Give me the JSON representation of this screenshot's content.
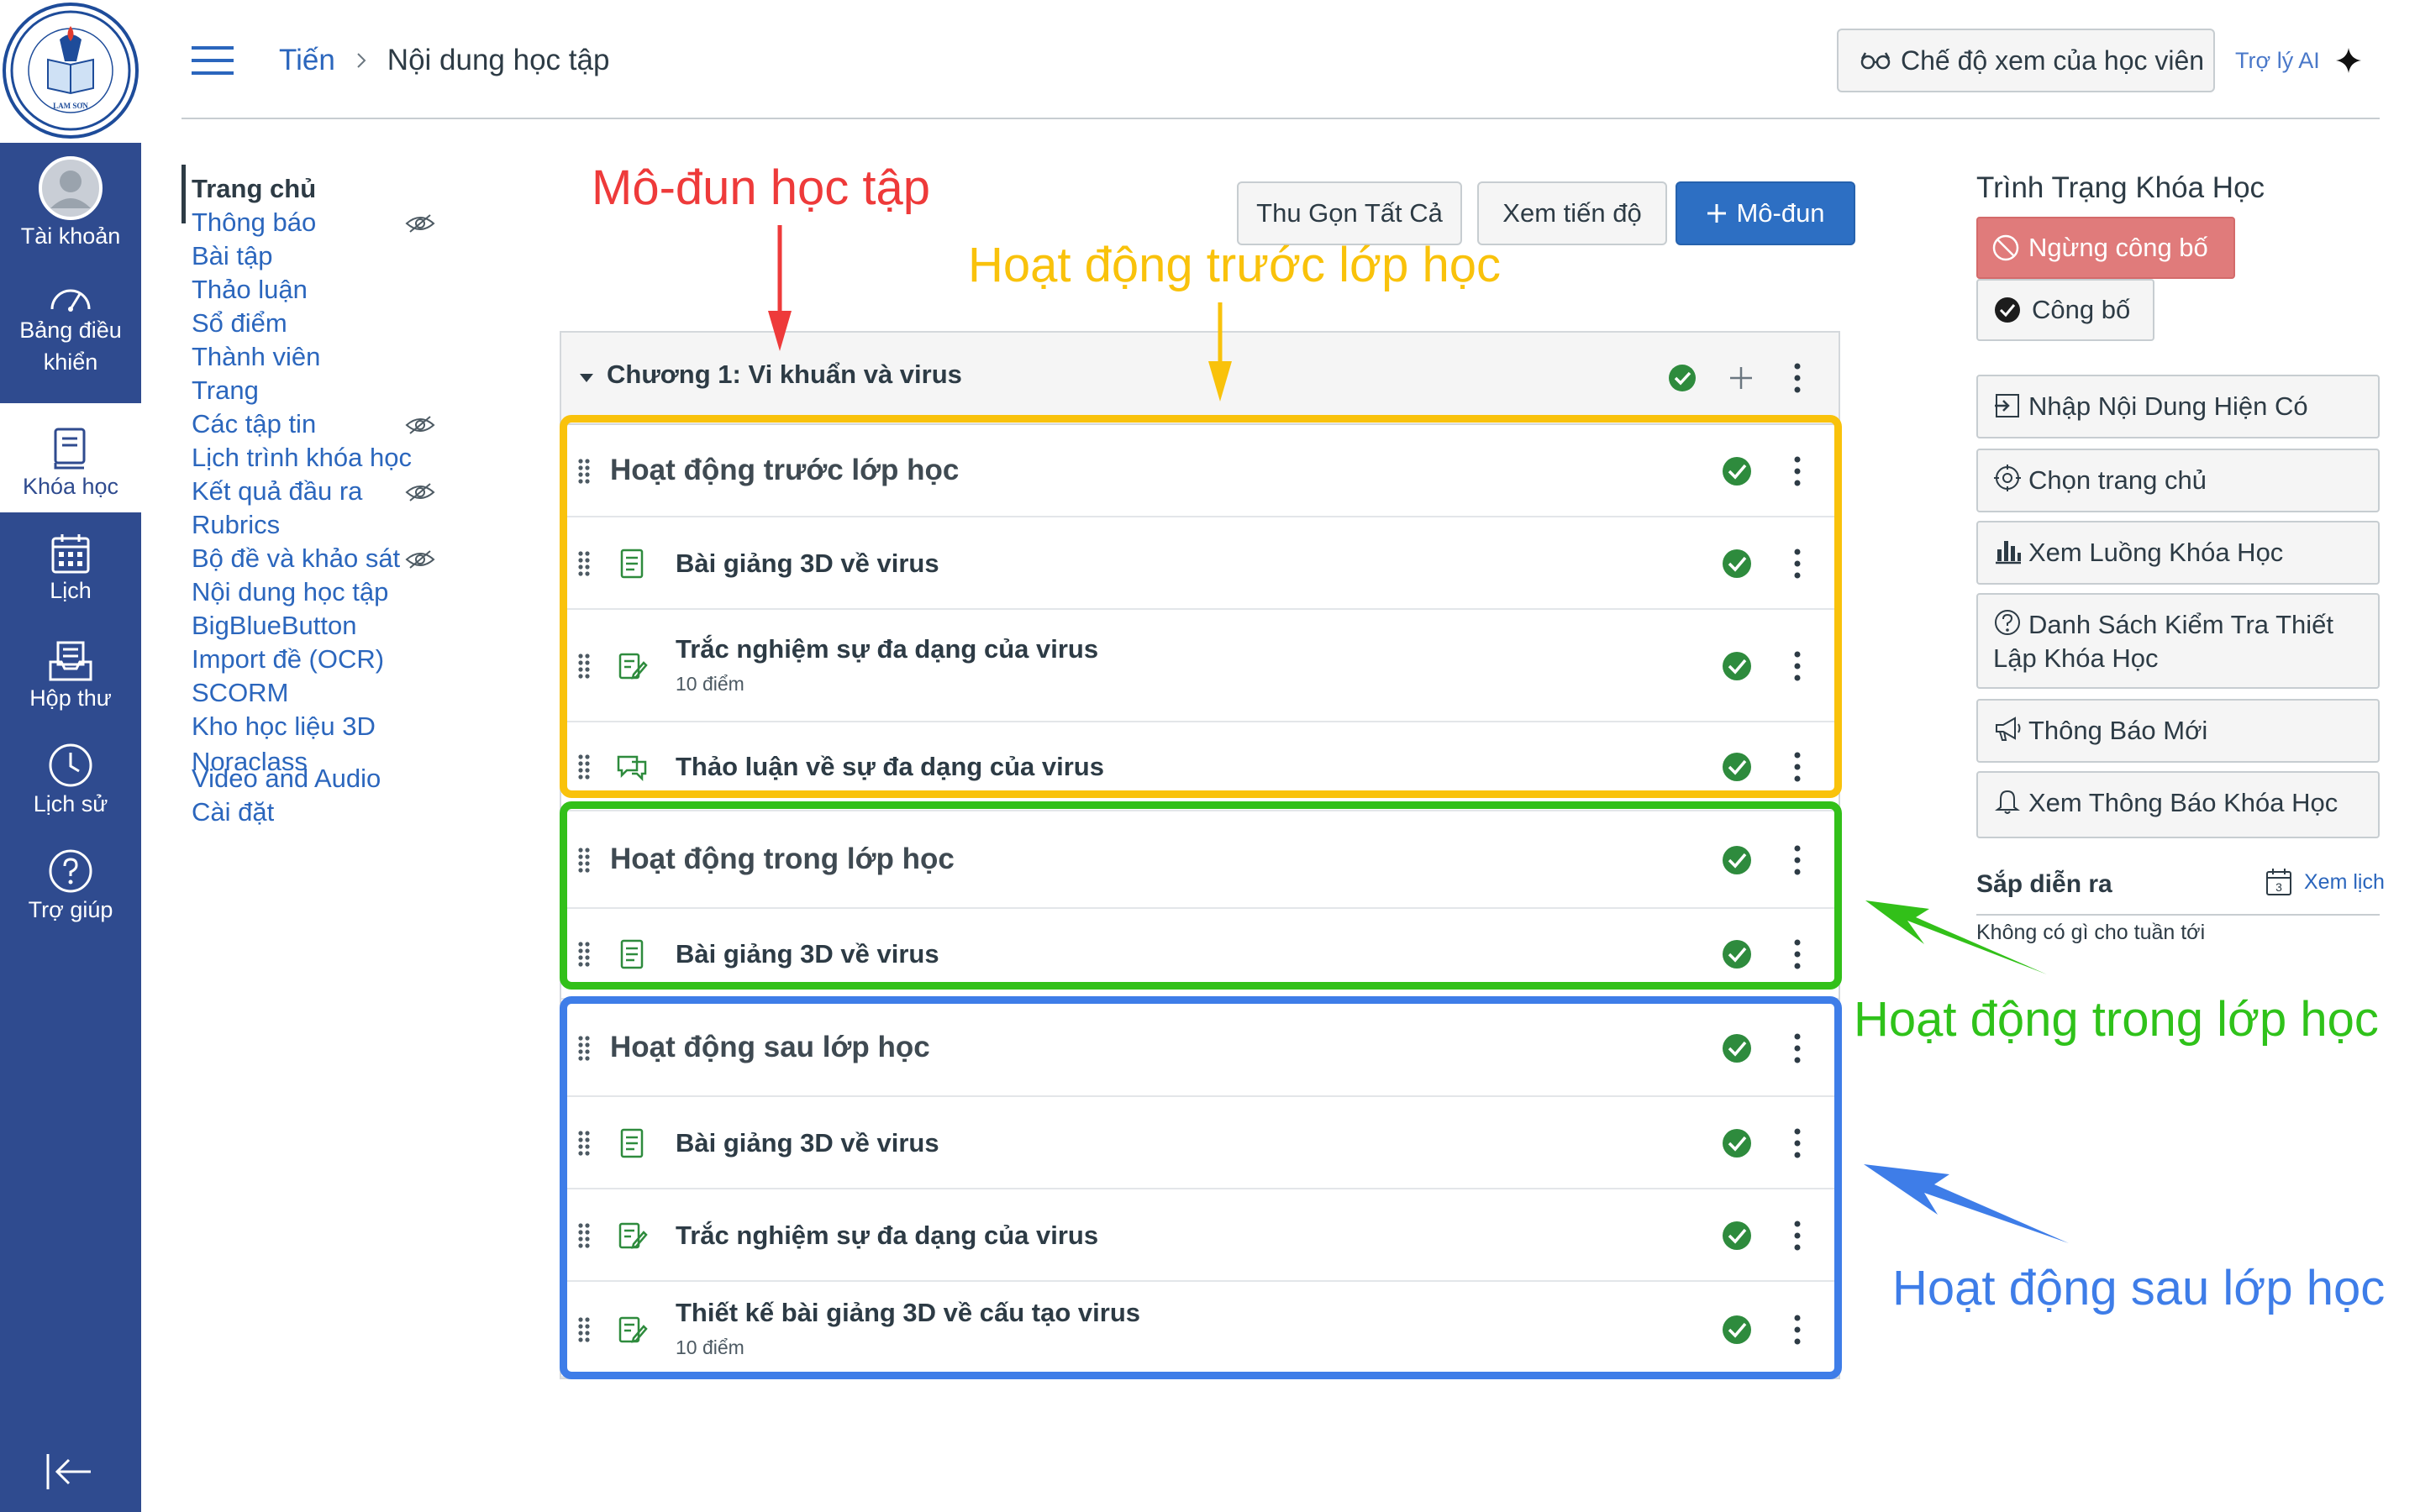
{
  "global_nav": {
    "items": [
      {
        "label": "Tài khoản",
        "icon": "account-avatar-icon"
      },
      {
        "label": "Bảng điều khiển",
        "icon": "dashboard-icon"
      },
      {
        "label": "Khóa học",
        "icon": "courses-icon",
        "active": true
      },
      {
        "label": "Lịch",
        "icon": "calendar-icon"
      },
      {
        "label": "Hộp thư",
        "icon": "inbox-icon"
      },
      {
        "label": "Lịch sử",
        "icon": "history-icon"
      },
      {
        "label": "Trợ giúp",
        "icon": "help-icon"
      }
    ]
  },
  "header": {
    "breadcrumb": {
      "course": "Tiến",
      "current": "Nội dung học tập"
    },
    "student_view_label": "Chế độ xem của học viên",
    "ai_assistant_label": "Trợ lý AI"
  },
  "course_nav": {
    "items": [
      {
        "label": "Trang chủ",
        "active": true
      },
      {
        "label": "Thông báo",
        "hidden": true
      },
      {
        "label": "Bài tập"
      },
      {
        "label": "Thảo luận"
      },
      {
        "label": "Sổ điểm"
      },
      {
        "label": "Thành viên"
      },
      {
        "label": "Trang"
      },
      {
        "label": "Các tập tin",
        "hidden": true
      },
      {
        "label": "Lịch trình khóa học"
      },
      {
        "label": "Kết quả đầu ra",
        "hidden": true
      },
      {
        "label": "Rubrics"
      },
      {
        "label": "Bộ đề và khảo sát",
        "hidden": true
      },
      {
        "label": "Nội dung học tập"
      },
      {
        "label": "BigBlueButton"
      },
      {
        "label": "Import đề (OCR)"
      },
      {
        "label": "SCORM"
      },
      {
        "label": "Kho học liệu 3D Noraclass"
      },
      {
        "label": "Video and Audio"
      },
      {
        "label": "Cài đặt"
      }
    ]
  },
  "toolbar": {
    "collapse_all": "Thu Gọn Tất Cả",
    "view_progress": "Xem tiến độ",
    "add_module": "Mô-đun"
  },
  "module": {
    "title": "Chương 1: Vi khuẩn và virus",
    "published": true,
    "rows": [
      {
        "kind": "header",
        "title": "Hoạt động trước lớp học"
      },
      {
        "kind": "item",
        "type": "page",
        "title": "Bài giảng 3D về virus"
      },
      {
        "kind": "item",
        "type": "quiz",
        "title": "Trắc nghiệm sự đa dạng của virus",
        "subtitle": "10 điểm"
      },
      {
        "kind": "item",
        "type": "discussion",
        "title": "Thảo luận về sự đa dạng của virus"
      },
      {
        "kind": "header",
        "title": "Hoạt động trong lớp học"
      },
      {
        "kind": "item",
        "type": "page",
        "title": "Bài giảng 3D về virus"
      },
      {
        "kind": "header",
        "title": "Hoạt động sau lớp học"
      },
      {
        "kind": "item",
        "type": "page",
        "title": "Bài giảng 3D về virus"
      },
      {
        "kind": "item",
        "type": "quiz",
        "title": "Trắc nghiệm sự đa dạng của virus"
      },
      {
        "kind": "item",
        "type": "quiz",
        "title": "Thiết kế bài giảng 3D về cấu tạo virus",
        "subtitle": "10 điểm"
      }
    ]
  },
  "annotations": {
    "module": "Mô-đun học tập",
    "pre_class": "Hoạt động trước lớp học",
    "in_class": "Hoạt động trong lớp học",
    "post_class": "Hoạt động sau lớp học"
  },
  "sidebar": {
    "course_status_heading": "Trình Trạng Khóa Học",
    "unpublish_label": "Ngừng công bố",
    "publish_label": "Công bố",
    "buttons": [
      {
        "label": "Nhập Nội Dung Hiện Có",
        "icon": "import-icon"
      },
      {
        "label": "Chọn trang chủ",
        "icon": "target-icon"
      },
      {
        "label": "Xem Luồng Khóa Học",
        "icon": "bar-chart-icon"
      },
      {
        "label": "Danh Sách Kiểm Tra Thiết Lập Khóa Học",
        "icon": "question-circle-icon"
      },
      {
        "label": "Thông Báo Mới",
        "icon": "megaphone-icon"
      },
      {
        "label": "Xem Thông Báo Khóa Học",
        "icon": "bell-icon"
      }
    ],
    "upcoming_heading": "Sắp diễn ra",
    "view_calendar_label": "Xem lịch",
    "calendar_day": "3",
    "upcoming_empty": "Không có gì cho tuần tới"
  },
  "colors": {
    "nav_bg": "#2f4b8f",
    "link": "#2b66bd",
    "publish_green": "#2e8b3d",
    "annotation_red": "#ee3a3a",
    "annotation_yellow": "#f9c20b",
    "annotation_green": "#32c019",
    "annotation_blue": "#3e7de8"
  }
}
